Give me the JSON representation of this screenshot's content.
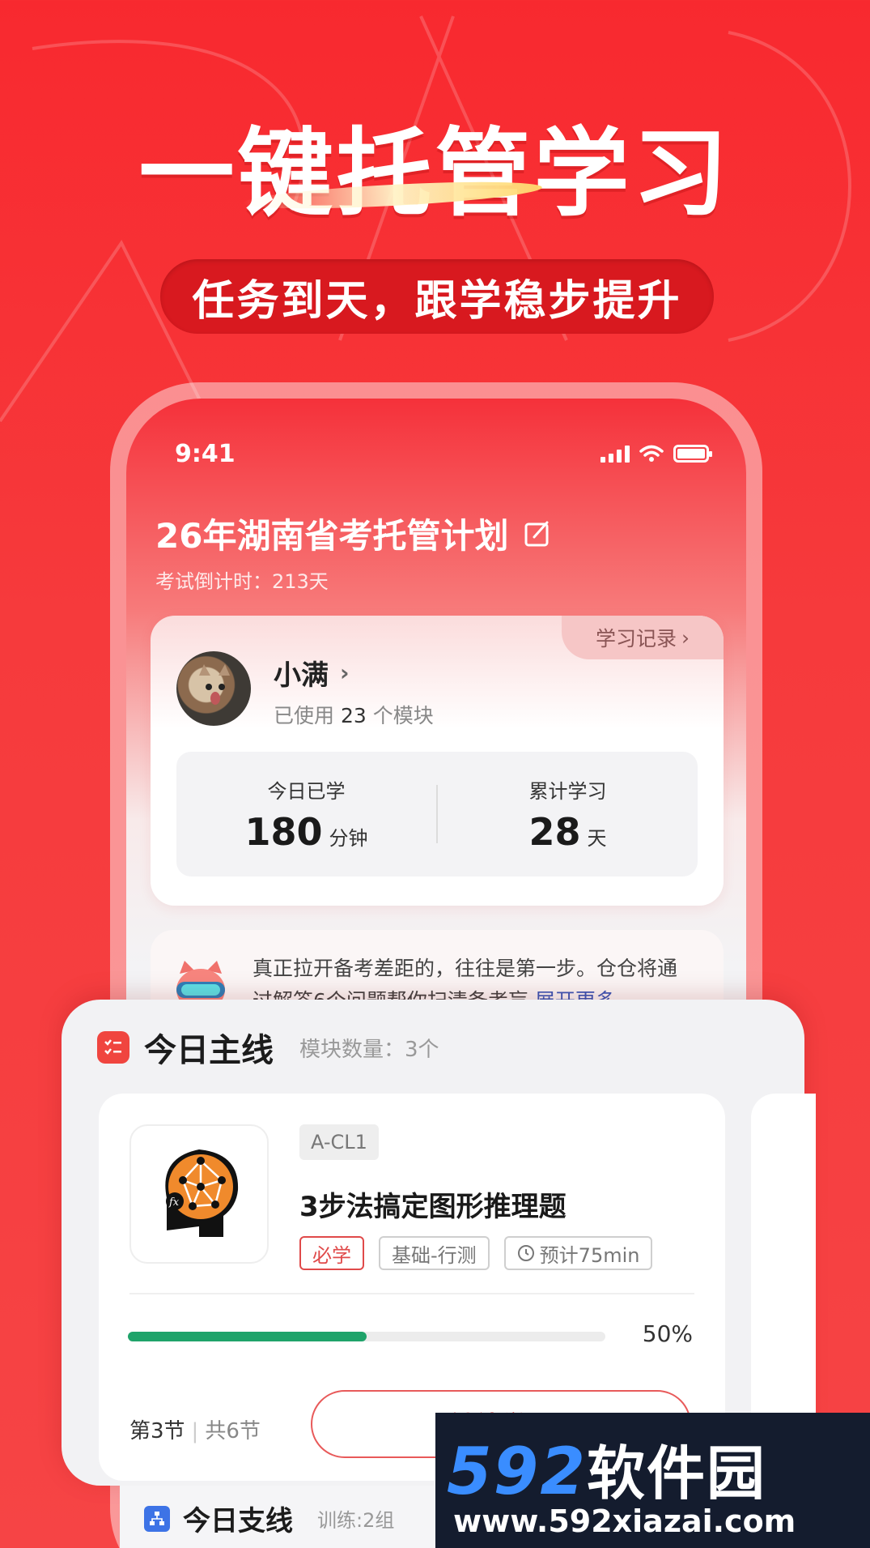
{
  "promo": {
    "headline": "一键托管学习",
    "subtitle": "任务到天，跟学稳步提升"
  },
  "status_bar": {
    "time": "9:41"
  },
  "plan": {
    "title": "26年湖南省考托管计划",
    "countdown": "考试倒计时：213天"
  },
  "user_card": {
    "study_record_label": "学习记录",
    "name": "小满",
    "modules_prefix": "已使用",
    "modules_count": "23",
    "modules_suffix": "个模块",
    "stats": [
      {
        "label": "今日已学",
        "value": "180",
        "unit": "分钟"
      },
      {
        "label": "累计学习",
        "value": "28",
        "unit": "天"
      }
    ]
  },
  "tip": {
    "text": "真正拉开备考差距的，往往是第一步。仓仓将通过解答6个问题帮你扫清备考盲",
    "more_label": "展开更多"
  },
  "main_line": {
    "title": "今日主线",
    "module_count": "模块数量：3个",
    "course": {
      "code": "A-CL1",
      "title": "3步法搞定图形推理题",
      "tags": [
        "必学",
        "基础-行测",
        "预计75min"
      ],
      "progress": 0.5,
      "progress_text": "50%",
      "lesson_current": "第3节",
      "lesson_total": "共6节",
      "continue_label": "继续学习"
    }
  },
  "branch_line": {
    "title": "今日支线",
    "train_count": "训练:2组"
  },
  "watermark": {
    "brand_num": "592",
    "brand_cn": "软件园",
    "url": "www.592xiazai.com"
  },
  "colors": {
    "brand_red": "#f63a3c",
    "progress_green": "#1fa36a",
    "link_blue": "#3c58b8"
  }
}
